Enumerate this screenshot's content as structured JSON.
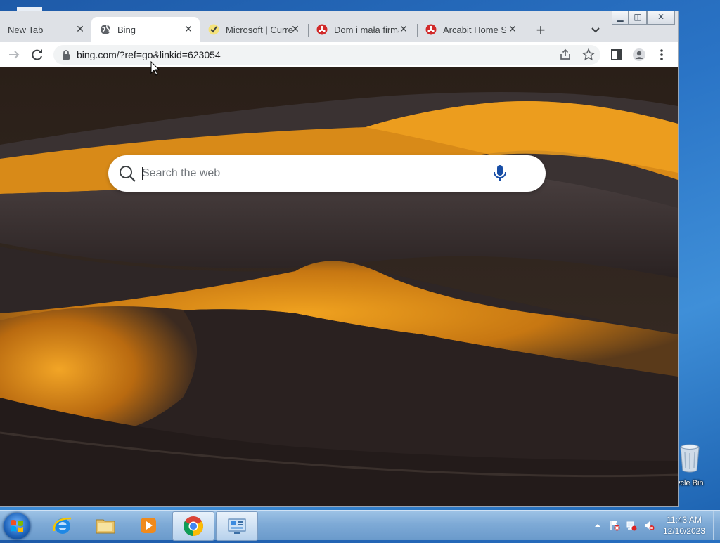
{
  "tabs": [
    {
      "title": "New Tab",
      "active": false
    },
    {
      "title": "Bing",
      "active": true
    },
    {
      "title": "Microsoft | Curre",
      "active": false
    },
    {
      "title": "Dom i mała firma",
      "active": false
    },
    {
      "title": "Arcabit Home Se",
      "active": false
    }
  ],
  "toolbar": {
    "url": "bing.com/?ref=go&linkid=623054"
  },
  "page": {
    "search_placeholder": "Search the web"
  },
  "desktop": {
    "recycle_bin_label": "ycle Bin"
  },
  "taskbar": {
    "time": "11:43 AM",
    "date": "12/10/2023"
  },
  "colors": {
    "accent": "#1a73e8",
    "bing_mic": "#174ea6",
    "taskbar": "#7eaad6"
  }
}
